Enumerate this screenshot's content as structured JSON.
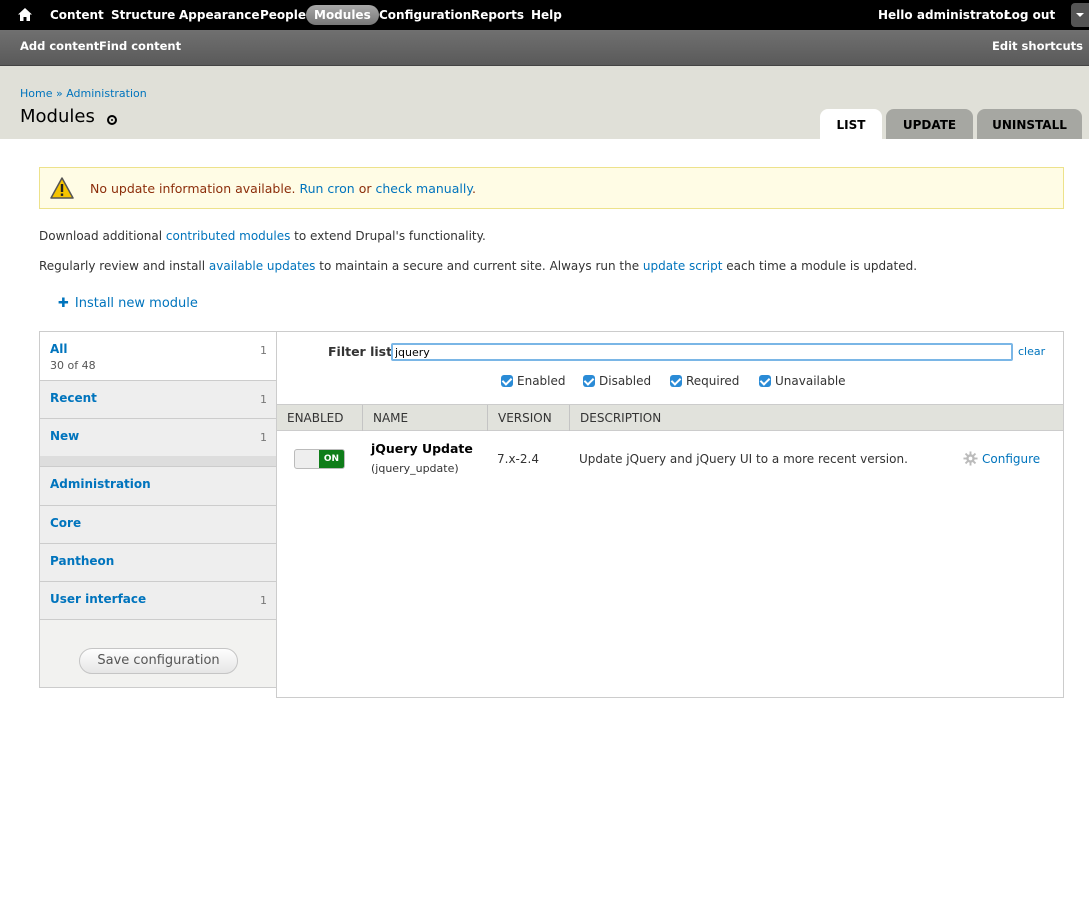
{
  "toolbar": {
    "menu": [
      "Content",
      "Structure",
      "Appearance",
      "People",
      "Modules",
      "Configuration",
      "Reports",
      "Help"
    ],
    "active_item": "Modules",
    "greeting_prefix": "Hello ",
    "user_name": "administrator",
    "logout": "Log out"
  },
  "shortcuts": {
    "items": [
      "Add content",
      "Find content"
    ],
    "edit": "Edit shortcuts"
  },
  "breadcrumb": [
    "Home",
    "Administration"
  ],
  "breadcrumb_sep": " » ",
  "page_title": "Modules",
  "tabs": [
    "LIST",
    "UPDATE",
    "UNINSTALL"
  ],
  "active_tab": "LIST",
  "messages": {
    "warning_prefix": "No update information available. ",
    "run_cron": "Run cron",
    "or": " or ",
    "check_manually": "check manually",
    "period": "."
  },
  "intro": {
    "p1_before": "Download additional ",
    "p1_link": "contributed modules",
    "p1_after": " to extend Drupal's functionality.",
    "p2_before": "Regularly review and install ",
    "p2_link1": "available updates",
    "p2_mid": " to maintain a secure and current site. Always run the ",
    "p2_link2": "update script",
    "p2_after": " each time a module is updated."
  },
  "install_new": "Install new module",
  "categories": [
    {
      "label": "All",
      "sub": "30 of 48",
      "count": "1"
    },
    {
      "label": "Recent",
      "count": "1"
    },
    {
      "label": "New",
      "count": "1"
    },
    {
      "label": "Administration",
      "count": ""
    },
    {
      "label": "Core",
      "count": ""
    },
    {
      "label": "Pantheon",
      "count": ""
    },
    {
      "label": "User interface",
      "count": "1"
    }
  ],
  "save_button": "Save configuration",
  "filter": {
    "label": "Filter list",
    "value": "jquery",
    "clear": "clear",
    "checkboxes": [
      "Enabled",
      "Disabled",
      "Required",
      "Unavailable"
    ]
  },
  "table": {
    "headers": [
      "ENABLED",
      "NAME",
      "VERSION",
      "DESCRIPTION"
    ],
    "rows": [
      {
        "toggle": "ON",
        "name": "jQuery Update",
        "machine_name": "(jquery_update)",
        "version": "7.x-2.4",
        "description": "Update jQuery and jQuery UI to a more recent version.",
        "action": "Configure"
      }
    ]
  },
  "colors": {
    "link": "#0074bd",
    "toolbar": "#000000",
    "toggle_on": "#0f7d19",
    "warning_bg": "#fffce5"
  }
}
